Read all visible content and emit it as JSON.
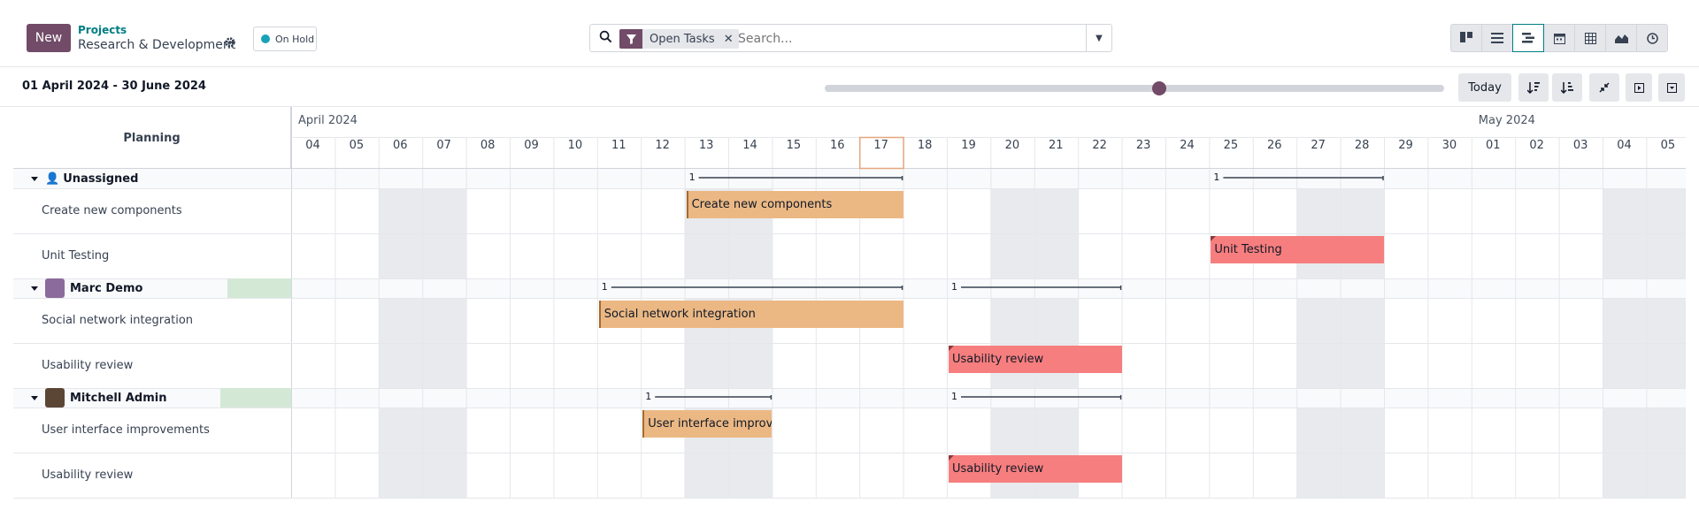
{
  "control_panel": {
    "new_label": "New",
    "breadcrumb_parent": "Projects",
    "breadcrumb_current": "Research & Development",
    "status_label": "On Hold",
    "status_color": "#17a2b8",
    "search": {
      "facet_value": "Open Tasks",
      "facet_icon": "filter-icon",
      "placeholder": "Search..."
    },
    "views": [
      "kanban-icon",
      "list-icon",
      "gantt-icon",
      "calendar-icon",
      "pivot-icon",
      "graph-icon",
      "activity-icon"
    ],
    "active_view": "gantt-icon"
  },
  "gantt_toolbar": {
    "range_label": "01 April 2024 - 30 June 2024",
    "scale_fraction": 0.54,
    "today_label": "Today"
  },
  "gantt": {
    "header_title": "Planning",
    "months": [
      {
        "label": "April 2024",
        "start_index": 0
      },
      {
        "label": "May 2024",
        "start_index": 27
      }
    ],
    "days": [
      "04",
      "05",
      "06",
      "07",
      "08",
      "09",
      "10",
      "11",
      "12",
      "13",
      "14",
      "15",
      "16",
      "17",
      "18",
      "19",
      "20",
      "21",
      "22",
      "23",
      "24",
      "25",
      "26",
      "27",
      "28",
      "29",
      "30",
      "01",
      "02",
      "03",
      "04",
      "05"
    ],
    "today_index": 13,
    "weekend_indices": [
      2,
      3,
      9,
      10,
      16,
      17,
      23,
      24,
      30,
      31
    ],
    "rows": [
      {
        "type": "group",
        "label": "Unassigned",
        "avatar": "person-icon",
        "counters": [
          {
            "start": 9,
            "end": 14,
            "count": "1"
          },
          {
            "start": 21,
            "end": 25,
            "count": "1"
          }
        ]
      },
      {
        "type": "task",
        "label": "Create new components",
        "pill": {
          "start": 9,
          "end": 14,
          "color": "orange",
          "label": "Create new components"
        }
      },
      {
        "type": "task",
        "label": "Unit Testing",
        "pill": {
          "start": 21,
          "end": 25,
          "color": "red",
          "label": "Unit Testing"
        }
      },
      {
        "type": "group",
        "label": "Marc Demo",
        "avatar": "avatar-marc",
        "counters": [
          {
            "start": 7,
            "end": 14,
            "count": "1"
          },
          {
            "start": 15,
            "end": 19,
            "count": "1"
          }
        ]
      },
      {
        "type": "task",
        "label": "Social network integration",
        "pill": {
          "start": 7,
          "end": 14,
          "color": "orange",
          "label": "Social network integration"
        }
      },
      {
        "type": "task",
        "label": "Usability review",
        "pill": {
          "start": 15,
          "end": 19,
          "color": "red",
          "label": "Usability review"
        }
      },
      {
        "type": "group",
        "label": "Mitchell Admin",
        "avatar": "avatar-mitchell",
        "counters": [
          {
            "start": 8,
            "end": 11,
            "count": "1"
          },
          {
            "start": 15,
            "end": 19,
            "count": "1"
          }
        ]
      },
      {
        "type": "task",
        "label": "User interface improvements",
        "pill": {
          "start": 8,
          "end": 11,
          "color": "orange",
          "label": "User interface improvements"
        }
      },
      {
        "type": "task",
        "label": "Usability review",
        "pill": {
          "start": 15,
          "end": 19,
          "color": "red",
          "label": "Usability review"
        }
      }
    ]
  }
}
